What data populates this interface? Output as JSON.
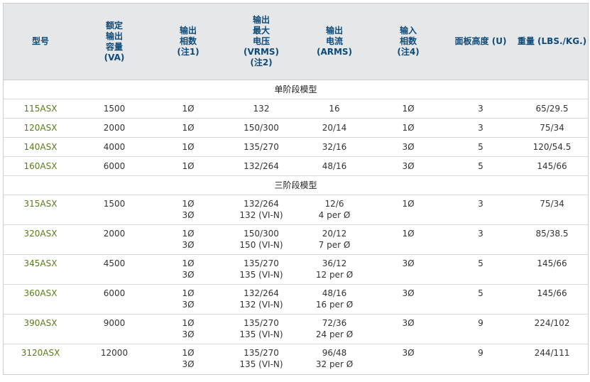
{
  "headers": [
    "型号",
    "额定\n输出\n容量\n(VA)",
    "输出\n相数\n(注1)",
    "输出\n最大\n电压\n(VRMS)\n(注2)",
    "输出\n电流\n(ARMS)",
    "输入\n相数\n(注4)",
    "面板高度 (U)",
    "重量 (LBS./KG.)"
  ],
  "sections": [
    {
      "title": "单阶段模型",
      "rows": [
        {
          "model": "115ASX",
          "va": "1500",
          "phase": [
            "1Ø"
          ],
          "voltage": [
            "132"
          ],
          "current": [
            "16"
          ],
          "input": "1Ø",
          "height": "3",
          "weight": "65/29.5"
        },
        {
          "model": "120ASX",
          "va": "2000",
          "phase": [
            "1Ø"
          ],
          "voltage": [
            "150/300"
          ],
          "current": [
            "20/14"
          ],
          "input": "1Ø",
          "height": "3",
          "weight": "75/34"
        },
        {
          "model": "140ASX",
          "va": "4000",
          "phase": [
            "1Ø"
          ],
          "voltage": [
            "135/270"
          ],
          "current": [
            "32/16"
          ],
          "input": "3Ø",
          "height": "5",
          "weight": "120/54.5"
        },
        {
          "model": "160ASX",
          "va": "6000",
          "phase": [
            "1Ø"
          ],
          "voltage": [
            "132/264"
          ],
          "current": [
            "48/16"
          ],
          "input": "3Ø",
          "height": "5",
          "weight": "145/66"
        }
      ]
    },
    {
      "title": "三阶段模型",
      "rows": [
        {
          "model": "315ASX",
          "va": "1500",
          "phase": [
            "1Ø",
            "3Ø"
          ],
          "voltage": [
            "132/264",
            "132 (VI-N)"
          ],
          "current": [
            "12/6",
            "4 per Ø"
          ],
          "input": "1Ø",
          "height": "3",
          "weight": "75/34"
        },
        {
          "model": "320ASX",
          "va": "2000",
          "phase": [
            "1Ø",
            "3Ø"
          ],
          "voltage": [
            "150/300",
            "150 (VI-N)"
          ],
          "current": [
            "20/12",
            "7 per Ø"
          ],
          "input": "1Ø",
          "height": "3",
          "weight": "85/38.5"
        },
        {
          "model": "345ASX",
          "va": "4500",
          "phase": [
            "1Ø",
            "3Ø"
          ],
          "voltage": [
            "135/270",
            "135 (VI-N)"
          ],
          "current": [
            "36/12",
            "12 per Ø"
          ],
          "input": "3Ø",
          "height": "5",
          "weight": "145/66"
        },
        {
          "model": "360ASX",
          "va": "6000",
          "phase": [
            "1Ø",
            "3Ø"
          ],
          "voltage": [
            "132/264",
            "132 (VI-N)"
          ],
          "current": [
            "48/16",
            "16 per Ø"
          ],
          "input": "3Ø",
          "height": "5",
          "weight": "145/66"
        },
        {
          "model": "390ASX",
          "va": "9000",
          "phase": [
            "1Ø",
            "3Ø"
          ],
          "voltage": [
            "135/270",
            "135 (VI-N)"
          ],
          "current": [
            "72/36",
            "24 per Ø"
          ],
          "input": "3Ø",
          "height": "9",
          "weight": "224/102"
        },
        {
          "model": "3120ASX",
          "va": "12000",
          "phase": [
            "1Ø",
            "3Ø"
          ],
          "voltage": [
            "135/270",
            "135 (VI-N)"
          ],
          "current": [
            "96/48",
            "32 per Ø"
          ],
          "input": "3Ø",
          "height": "9",
          "weight": "244/111"
        }
      ]
    }
  ],
  "colors": {
    "header_bg": "#e6e7e8",
    "header_text": "#0e4a78",
    "model_text": "#5b7a1a",
    "border": "#c9ccd0"
  }
}
